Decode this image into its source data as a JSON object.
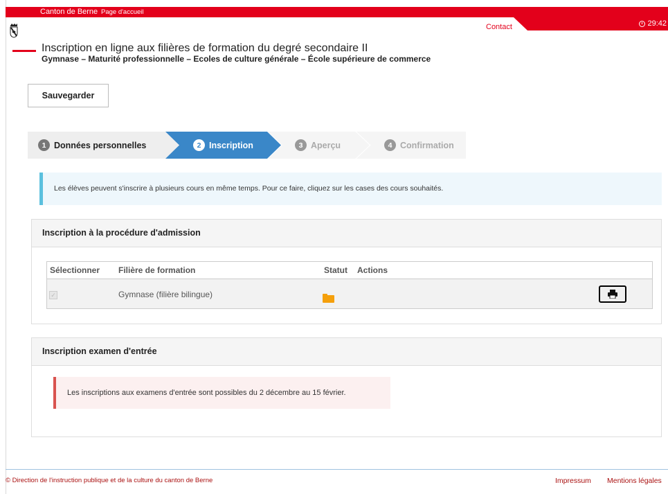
{
  "header": {
    "brand": "Canton de Berne",
    "home_link": "Page d'accueil",
    "contact": "Contact",
    "timer": "29:42",
    "title": "Inscription en ligne aux filières de formation du degré secondaire II",
    "subtitle": "Gymnase – Maturité professionnelle – Ecoles de culture générale – École supérieure de commerce"
  },
  "toolbar": {
    "save_label": "Sauvegarder"
  },
  "wizard": {
    "steps": [
      {
        "num": "1",
        "label": "Données personnelles",
        "state": "done"
      },
      {
        "num": "2",
        "label": "Inscription",
        "state": "active"
      },
      {
        "num": "3",
        "label": "Aperçu",
        "state": "disabled"
      },
      {
        "num": "4",
        "label": "Confirmation",
        "state": "disabled"
      }
    ]
  },
  "info_text": "Les élèves peuvent s'inscrire à plusieurs cours en même temps. Pour ce faire, cliquez sur les cases des cours souhaités.",
  "admission": {
    "title": "Inscription à la procédure d'admission",
    "columns": [
      "Sélectionner",
      "Filière de formation",
      "Statut",
      "Actions"
    ],
    "rows": [
      {
        "selected": true,
        "program": "Gymnase (filière bilingue)",
        "status_icon": "folder-icon",
        "action_icon": "print-icon"
      }
    ]
  },
  "exam": {
    "title": "Inscription examen d'entrée",
    "alert": "Les inscriptions aux examens d'entrée sont possibles du 2 décembre au 15 février."
  },
  "footer": {
    "copyright": "© Direction de l'instruction publique et de la culture du canton de Berne",
    "impressum": "Impressum",
    "legal": "Mentions légales"
  },
  "colors": {
    "brand_red": "#e3001b",
    "active_step": "#3a87c8",
    "info_border": "#5bc0de",
    "alert_border": "#d9534f",
    "folder": "#f5a00c"
  }
}
